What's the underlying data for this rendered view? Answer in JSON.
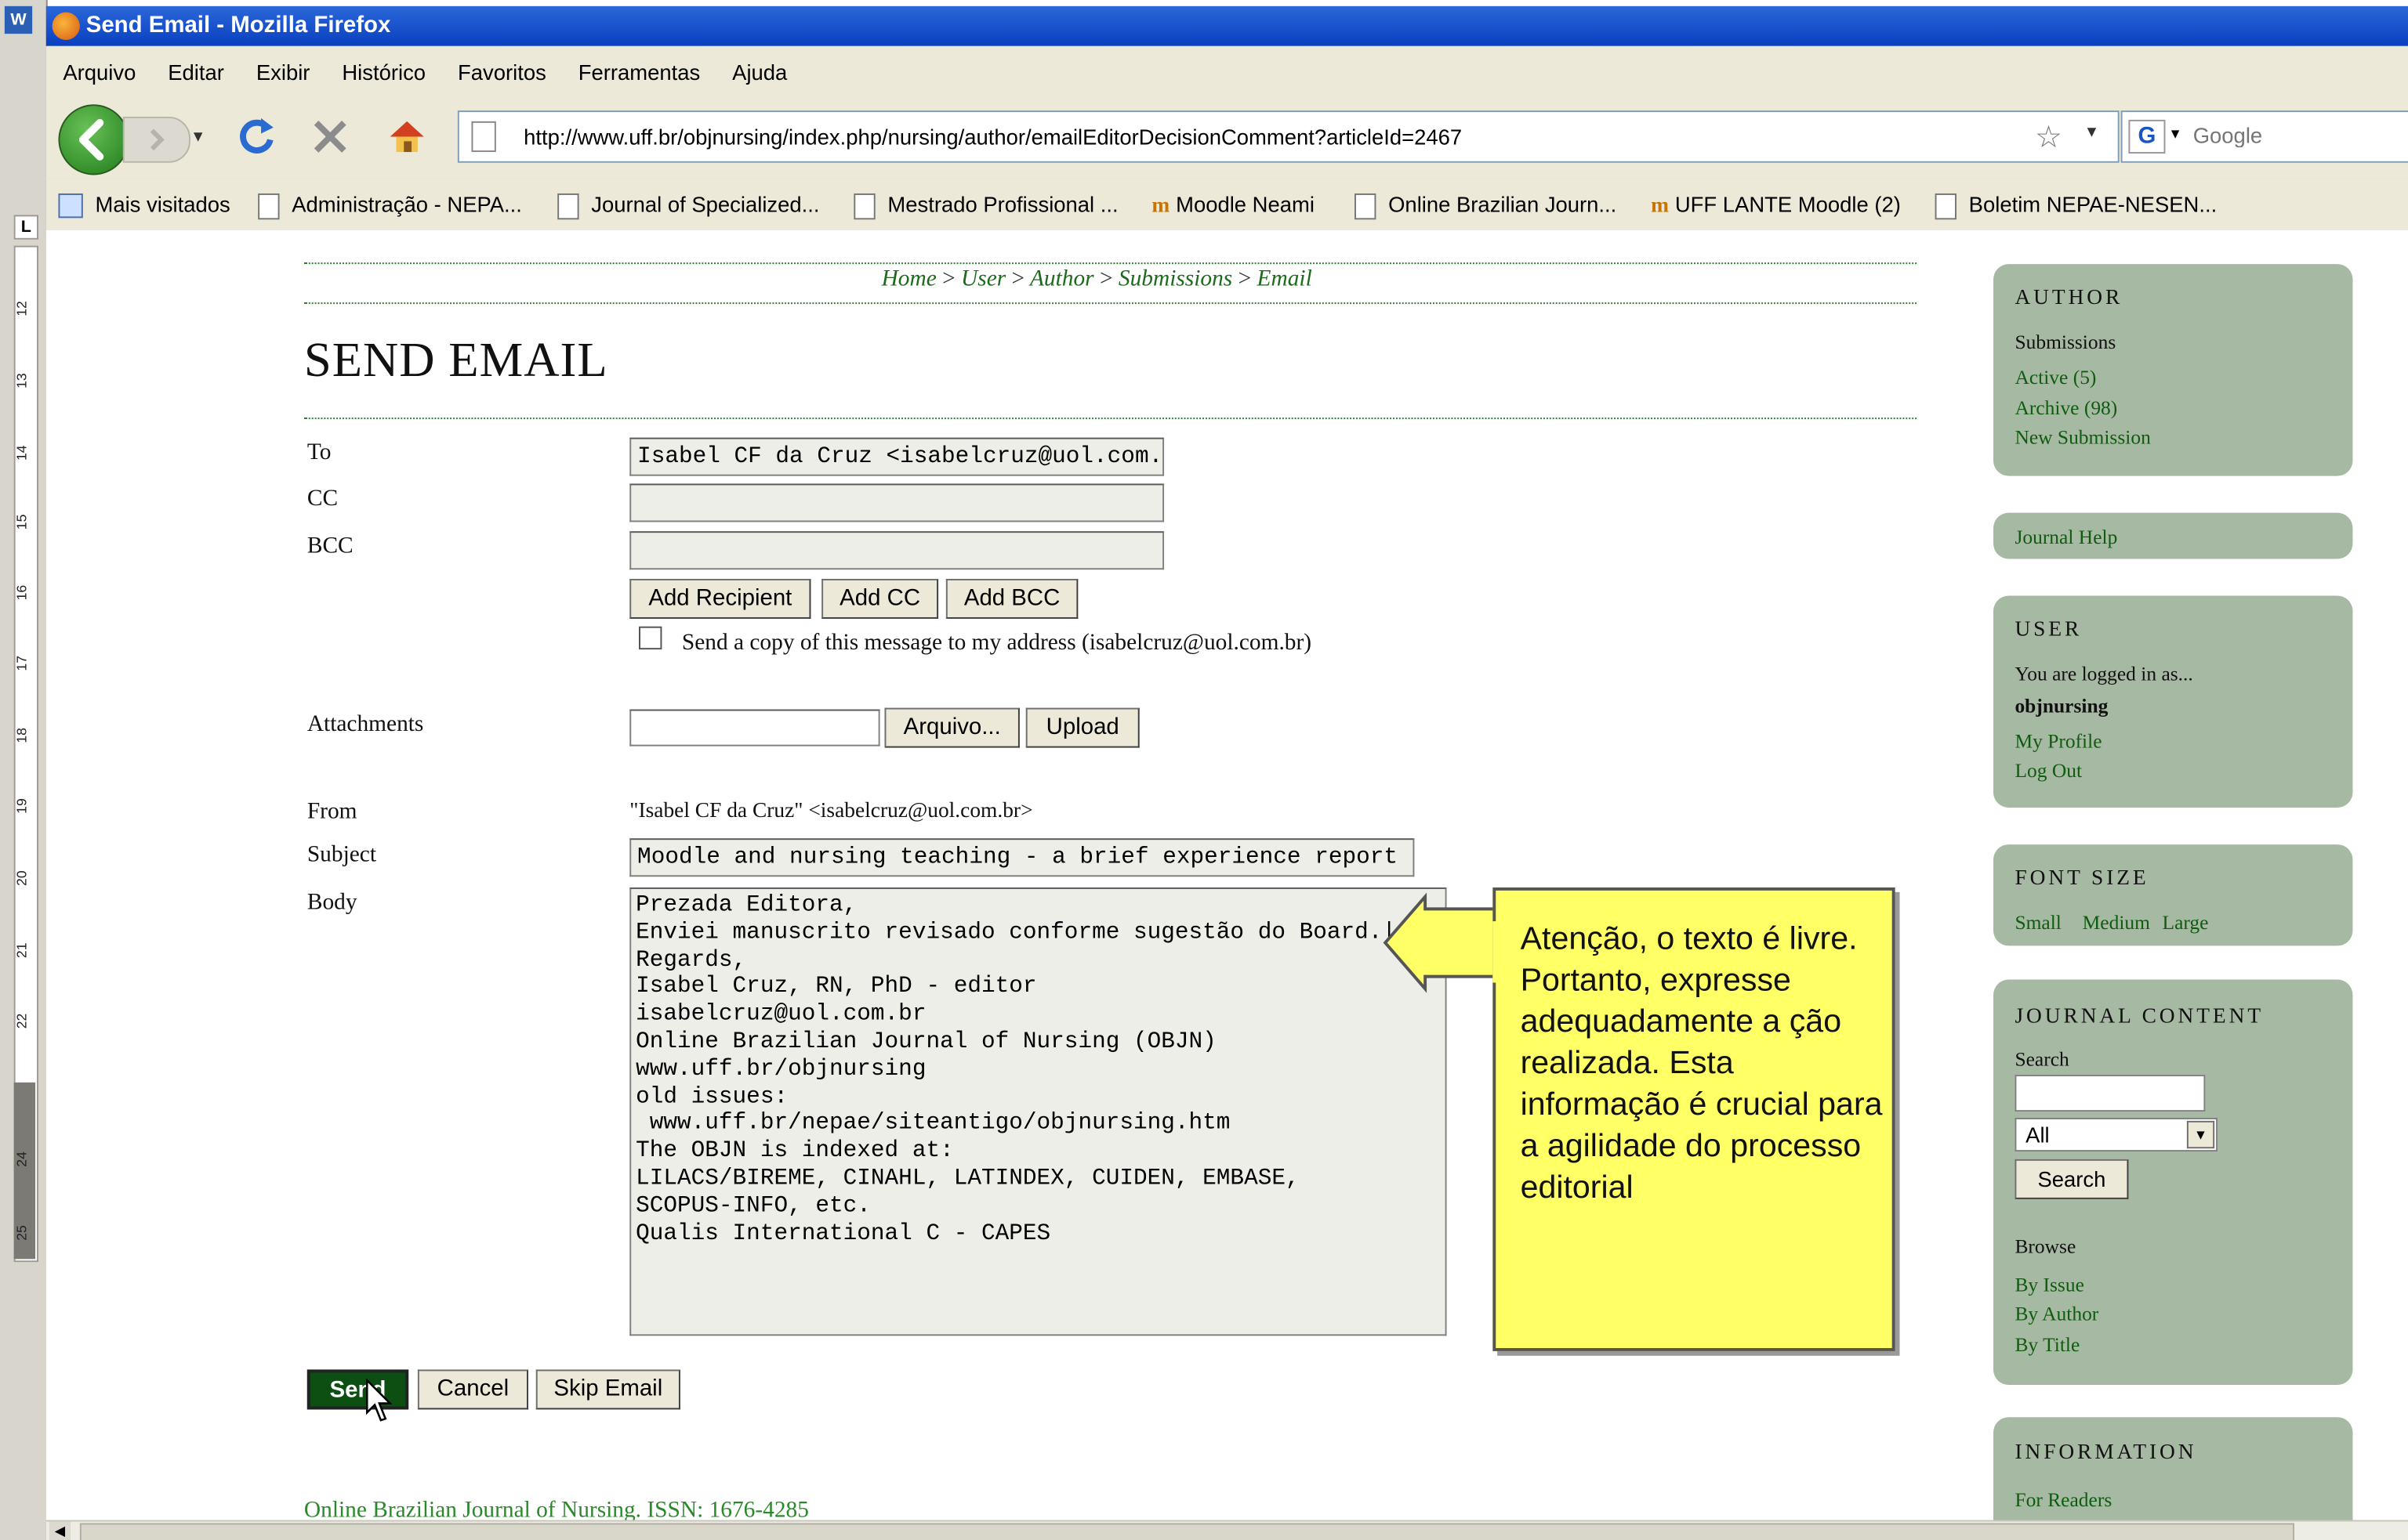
{
  "window": {
    "title": "Send Email - Mozilla Firefox"
  },
  "word_ruler": {
    "labels": [
      "12",
      "13",
      "14",
      "15",
      "16",
      "17",
      "18",
      "19",
      "20",
      "21",
      "22",
      "24",
      "25"
    ]
  },
  "menu": [
    "Arquivo",
    "Editar",
    "Exibir",
    "Histórico",
    "Favoritos",
    "Ferramentas",
    "Ajuda"
  ],
  "address": {
    "url": "http://www.uff.br/objnursing/index.php/nursing/author/emailEditorDecisionComment?articleId=2467"
  },
  "search": {
    "placeholder": "Google"
  },
  "bookmarks": [
    "Mais visitados",
    "Administração - NEPA...",
    "Journal of Specialized...",
    "Mestrado Profissional ...",
    "Moodle Neami",
    "Online Brazilian Journ...",
    "UFF LANTE Moodle (2)",
    "Boletim NEPAE-NESEN..."
  ],
  "breadcrumb": {
    "home": "Home",
    "user": "User",
    "author": "Author",
    "submissions": "Submissions",
    "email": "Email",
    "sep": ">"
  },
  "page": {
    "title": "SEND EMAIL"
  },
  "form": {
    "to_label": "To",
    "to_value": "Isabel CF da Cruz <isabelcruz@uol.com.br>",
    "cc_label": "CC",
    "bcc_label": "BCC",
    "add_recipient": "Add Recipient",
    "add_cc": "Add CC",
    "add_bcc": "Add BCC",
    "copy_label": "Send a copy of this message to my address (isabelcruz@uol.com.br)",
    "attachments_label": "Attachments",
    "browse": "Arquivo...",
    "upload": "Upload",
    "from_label": "From",
    "from_value": "\"Isabel CF da Cruz\" <isabelcruz@uol.com.br>",
    "subject_label": "Subject",
    "subject_value": "Moodle and nursing teaching - a brief experience report",
    "body_label": "Body",
    "body_value": "Prezada Editora,\nEnviei manuscrito revisado conforme sugestão do Board.|\nRegards,\nIsabel Cruz, RN, PhD - editor\nisabelcruz@uol.com.br\nOnline Brazilian Journal of Nursing (OBJN)\nwww.uff.br/objnursing\nold issues:\n www.uff.br/nepae/siteantigo/objnursing.htm\nThe OBJN is indexed at:\nLILACS/BIREME, CINAHL, LATINDEX, CUIDEN, EMBASE,\nSCOPUS-INFO, etc.\nQualis International C - CAPES",
    "send": "Send",
    "cancel": "Cancel",
    "skip": "Skip Email"
  },
  "callout": {
    "text": "Atenção, o texto é livre. Portanto, expresse adequadamente a ção realizada. Esta informação é crucial para a agilidade do processo editorial"
  },
  "footer": {
    "text": "Online Brazilian Journal of Nursing. ISSN: 1676-4285"
  },
  "sidebar": {
    "author": {
      "heading": "AUTHOR",
      "submissions": "Submissions",
      "active": "Active (5)",
      "archive": "Archive (98)",
      "new": "New Submission"
    },
    "help": "Journal Help",
    "user": {
      "heading": "USER",
      "logged": "You are logged in as...",
      "username": "objnursing",
      "profile": "My Profile",
      "logout": "Log Out"
    },
    "font": {
      "heading": "FONT SIZE",
      "small": "Small",
      "medium": "Medium",
      "large": "Large"
    },
    "journal": {
      "heading": "JOURNAL CONTENT",
      "search_label": "Search",
      "select": "All",
      "search_btn": "Search",
      "browse": "Browse",
      "by_issue": "By Issue",
      "by_author": "By Author",
      "by_title": "By Title"
    },
    "info": {
      "heading": "INFORMATION",
      "readers": "For Readers"
    }
  },
  "colors": {
    "link": "#1b6b1b",
    "sidebar_bg": "#a6b9a2",
    "callout_bg": "#ffff66",
    "send_btn": "#0d4f12"
  }
}
